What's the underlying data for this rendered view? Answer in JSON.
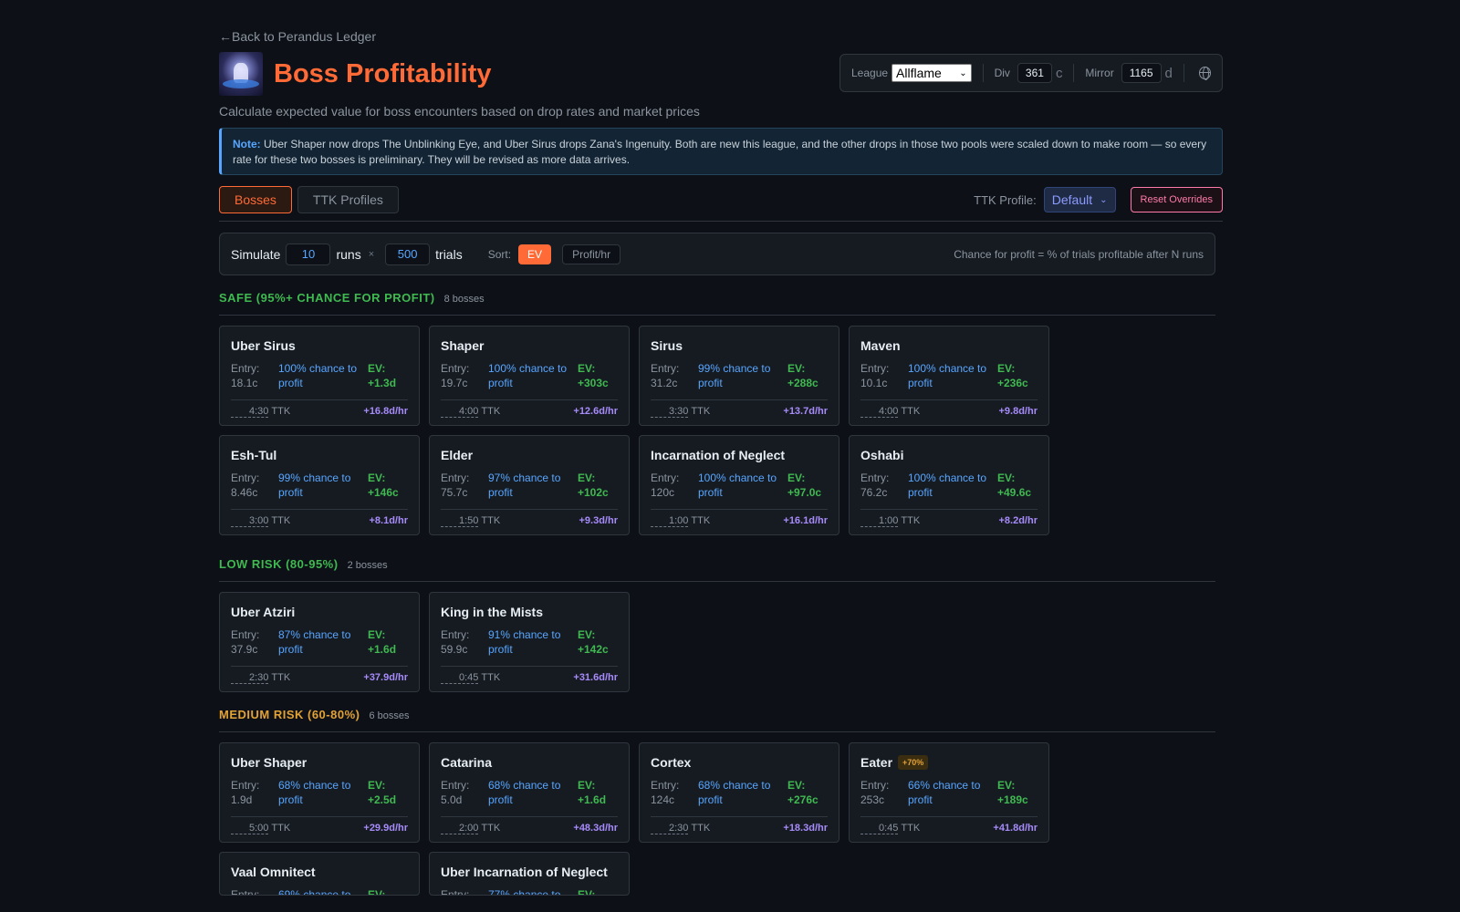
{
  "back_link": "←Back to Perandus Ledger",
  "title": "Boss Profitability",
  "subtitle": "Calculate expected value for boss encounters based on drop rates and market prices",
  "settings": {
    "league_label": "League",
    "league_value": "Allflame",
    "div_label": "Div",
    "div_value": "361",
    "div_unit": "c",
    "mirror_label": "Mirror",
    "mirror_value": "1165",
    "mirror_unit": "d"
  },
  "note": {
    "prefix": "Note:",
    "text": " Uber Shaper now drops The Unblinking Eye, and Uber Sirus drops Zana's Ingenuity. Both are new this league, and the other drops in those two pools were scaled down to make room — so every rate for these two bosses is preliminary. They will be revised as more data arrives."
  },
  "tabs": [
    {
      "label": "Bosses",
      "active": true
    },
    {
      "label": "TTK Profiles",
      "active": false
    }
  ],
  "ttk_profile_label": "TTK Profile:",
  "ttk_profile_value": "Default",
  "reset_label": "Reset Overrides",
  "simulate": {
    "label": "Simulate",
    "runs_value": "10",
    "runs_label": "runs",
    "times": "×",
    "trials_value": "500",
    "trials_label": "trials",
    "sort_label": "Sort:",
    "sort_ev": "EV",
    "sort_profit": "Profit/hr",
    "note": "Chance for profit = % of trials profitable after N runs"
  },
  "sections": [
    {
      "title": "SAFE (95%+ CHANCE FOR PROFIT)",
      "count": "8 bosses",
      "color": "#3fb950",
      "cards": [
        {
          "name": "Uber Sirus",
          "entry_label": "Entry:",
          "entry": "18.1c",
          "chance": "100% chance to profit",
          "ev_label": "EV:",
          "ev": "+1.3d",
          "ttk": "4:30",
          "rate": "+16.8d/hr"
        },
        {
          "name": "Shaper",
          "entry_label": "Entry:",
          "entry": "19.7c",
          "chance": "100% chance to profit",
          "ev_label": "EV:",
          "ev": "+303c",
          "ttk": "4:00",
          "rate": "+12.6d/hr"
        },
        {
          "name": "Sirus",
          "entry_label": "Entry:",
          "entry": "31.2c",
          "chance": "99% chance to profit",
          "ev_label": "EV:",
          "ev": "+288c",
          "ttk": "3:30",
          "rate": "+13.7d/hr"
        },
        {
          "name": "Maven",
          "entry_label": "Entry:",
          "entry": "10.1c",
          "chance": "100% chance to profit",
          "ev_label": "EV:",
          "ev": "+236c",
          "ttk": "4:00",
          "rate": "+9.8d/hr"
        },
        {
          "name": "Esh-Tul",
          "entry_label": "Entry:",
          "entry": "8.46c",
          "chance": "99% chance to profit",
          "ev_label": "EV:",
          "ev": "+146c",
          "ttk": "3:00",
          "rate": "+8.1d/hr"
        },
        {
          "name": "Elder",
          "entry_label": "Entry:",
          "entry": "75.7c",
          "chance": "97% chance to profit",
          "ev_label": "EV:",
          "ev": "+102c",
          "ttk": "1:50",
          "rate": "+9.3d/hr"
        },
        {
          "name": "Incarnation of Neglect",
          "entry_label": "Entry:",
          "entry": "120c",
          "chance": "100% chance to profit",
          "ev_label": "EV:",
          "ev": "+97.0c",
          "ttk": "1:00",
          "rate": "+16.1d/hr"
        },
        {
          "name": "Oshabi",
          "entry_label": "Entry:",
          "entry": "76.2c",
          "chance": "100% chance to profit",
          "ev_label": "EV:",
          "ev": "+49.6c",
          "ttk": "1:00",
          "rate": "+8.2d/hr"
        }
      ]
    },
    {
      "title": "LOW RISK (80-95%)",
      "count": "2 bosses",
      "color": "#3fb950",
      "cards": [
        {
          "name": "Uber Atziri",
          "entry_label": "Entry:",
          "entry": "37.9c",
          "chance": "87% chance to profit",
          "ev_label": "EV:",
          "ev": "+1.6d",
          "ttk": "2:30",
          "rate": "+37.9d/hr"
        },
        {
          "name": "King in the Mists",
          "entry_label": "Entry:",
          "entry": "59.9c",
          "chance": "91% chance to profit",
          "ev_label": "EV:",
          "ev": "+142c",
          "ttk": "0:45",
          "rate": "+31.6d/hr"
        }
      ]
    },
    {
      "title": "MEDIUM RISK (60-80%)",
      "count": "6 bosses",
      "color": "#e3a234",
      "cards": [
        {
          "name": "Uber Shaper",
          "entry_label": "Entry:",
          "entry": "1.9d",
          "chance": "68% chance to profit",
          "ev_label": "EV:",
          "ev": "+2.5d",
          "ttk": "5:00",
          "rate": "+29.9d/hr"
        },
        {
          "name": "Catarina",
          "entry_label": "Entry:",
          "entry": "5.0d",
          "chance": "68% chance to profit",
          "ev_label": "EV:",
          "ev": "+1.6d",
          "ttk": "2:00",
          "rate": "+48.3d/hr"
        },
        {
          "name": "Cortex",
          "entry_label": "Entry:",
          "entry": "124c",
          "chance": "68% chance to profit",
          "ev_label": "EV:",
          "ev": "+276c",
          "ttk": "2:30",
          "rate": "+18.3d/hr"
        },
        {
          "name": "Eater",
          "badge": "+70%",
          "entry_label": "Entry:",
          "entry": "253c",
          "chance": "66% chance to profit",
          "ev_label": "EV:",
          "ev": "+189c",
          "ttk": "0:45",
          "rate": "+41.8d/hr"
        },
        {
          "name": "Vaal Omnitect",
          "entry_label": "Entry:",
          "chance": "69% chance to",
          "ev_label": "EV:"
        },
        {
          "name": "Uber Incarnation of Neglect",
          "entry_label": "Entry:",
          "chance": "77% chance to",
          "ev_label": "EV:"
        }
      ]
    }
  ]
}
